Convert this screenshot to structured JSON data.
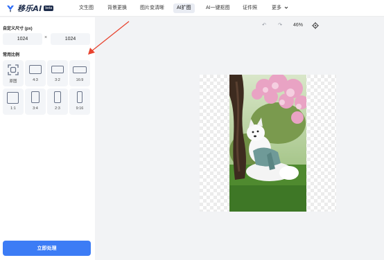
{
  "header": {
    "logo_text": "移乐AI",
    "logo_badge": "beta",
    "nav": [
      {
        "label": "文生图",
        "active": false
      },
      {
        "label": "背景更换",
        "active": false
      },
      {
        "label": "图片变清晰",
        "active": false
      },
      {
        "label": "AI扩图",
        "active": true
      },
      {
        "label": "AI一键抠图",
        "active": false
      },
      {
        "label": "证件照",
        "active": false
      },
      {
        "label": "更多",
        "active": false
      }
    ]
  },
  "sidebar": {
    "custom_size_label": "自定义尺寸 (px)",
    "width_value": "1024",
    "height_value": "1024",
    "separator": "×",
    "ratio_section_label": "常用比例",
    "ratios": [
      {
        "label": "原图",
        "icon": "original-size-icon"
      },
      {
        "label": "4:3",
        "icon": "ratio-4-3-icon"
      },
      {
        "label": "3:2",
        "icon": "ratio-3-2-icon"
      },
      {
        "label": "16:9",
        "icon": "ratio-16-9-icon"
      },
      {
        "label": "1:1",
        "icon": "ratio-1-1-icon"
      },
      {
        "label": "3:4",
        "icon": "ratio-3-4-icon"
      },
      {
        "label": "2:3",
        "icon": "ratio-2-3-icon"
      },
      {
        "label": "9:16",
        "icon": "ratio-9-16-icon"
      }
    ],
    "process_button": "立即处理"
  },
  "canvas": {
    "undo_icon": "↶",
    "redo_icon": "↷",
    "zoom": "46%",
    "fit_icon": "crosshair-fit-icon",
    "image_subject": "white Samoyed dog under pink cherry blossom tree"
  },
  "colors": {
    "accent": "#3c7cf5",
    "annotation_arrow": "#e8432e"
  }
}
